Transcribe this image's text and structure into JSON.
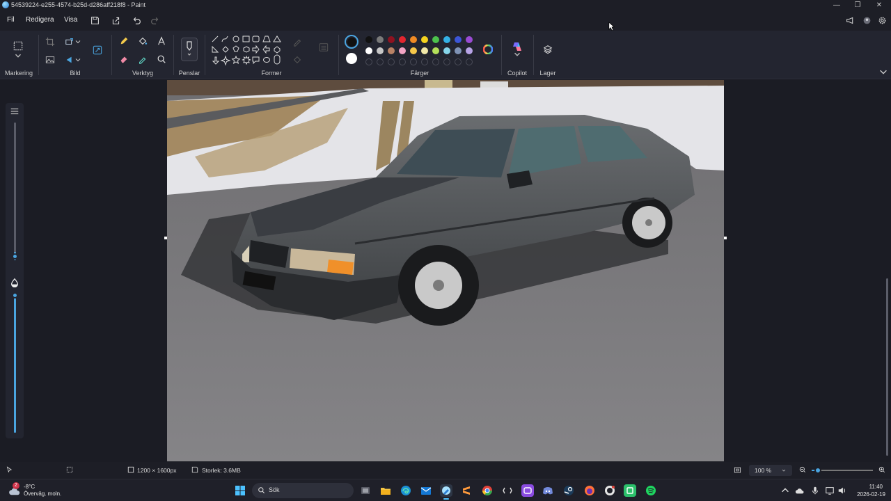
{
  "window": {
    "title": "54539224-e255-4574-b25d-d286aff218f8 - Paint",
    "minimize_glyph": "—",
    "maximize_glyph": "❐",
    "close_glyph": "✕"
  },
  "menu": {
    "file": "Fil",
    "edit": "Redigera",
    "view": "Visa"
  },
  "ribbon": {
    "groups": {
      "selection": "Markering",
      "image": "Bild",
      "tools": "Verktyg",
      "brushes": "Penslar",
      "shapes": "Former",
      "colors": "Färger",
      "copilot": "Copilot",
      "layers": "Lager"
    },
    "palette_row1": [
      "#111111",
      "#7a7a7a",
      "#8f1220",
      "#e3262f",
      "#f08a24",
      "#f5d31f",
      "#4cc24c",
      "#34b1e6",
      "#3c56d8",
      "#9a4bd4"
    ],
    "palette_row2": [
      "#ffffff",
      "#c6c6c6",
      "#b98366",
      "#f3a4c4",
      "#f7c84a",
      "#f1e8a8",
      "#b4e05a",
      "#86d5ea",
      "#7f93b6",
      "#b7a3e6"
    ],
    "primary_color": "#111111",
    "secondary_color": "#ffffff"
  },
  "status": {
    "dimensions": "1200 × 1600px",
    "size": "Storlek: 3.6MB",
    "zoom": "100 %",
    "zoom_level": 0.1
  },
  "taskbar": {
    "weather_temp": "-8°C",
    "weather_desc": "Överväg. moln.",
    "weather_badge": "2",
    "search_placeholder": "Sök",
    "time": "11:40",
    "date": "2026-02-19"
  }
}
